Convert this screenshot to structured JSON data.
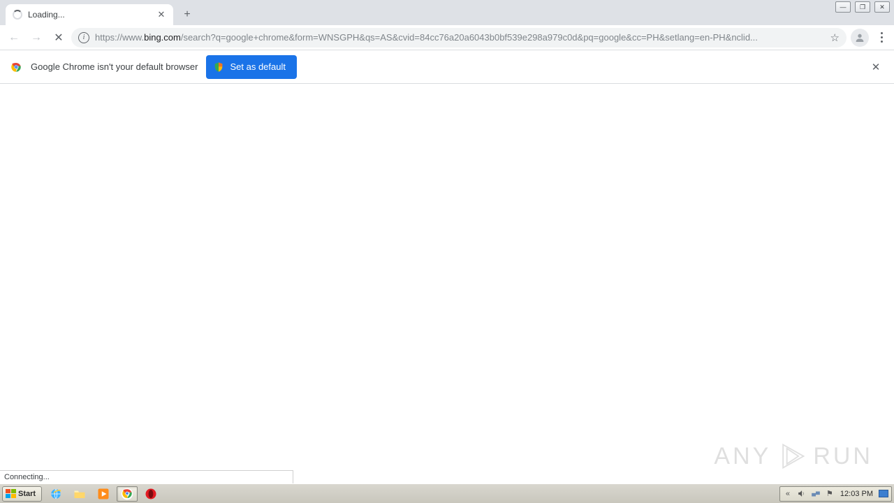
{
  "tab": {
    "title": "Loading..."
  },
  "window_controls": {
    "min": "—",
    "max": "❐",
    "close": "✕"
  },
  "nav": {
    "back": "←",
    "forward": "→",
    "stop": "✕"
  },
  "address": {
    "scheme": "https://",
    "subhost": "www.",
    "host": "bing.com",
    "path": "/search?q=google+chrome&form=WNSGPH&qs=AS&cvid=84cc76a20a6043b0bf539e298a979c0d&pq=google&cc=PH&setlang=en-PH&nclid..."
  },
  "infobar": {
    "message": "Google Chrome isn't your default browser",
    "button": "Set as default"
  },
  "status": "Connecting...",
  "watermark": {
    "left": "ANY",
    "right": "RUN"
  },
  "taskbar": {
    "start": "Start",
    "clock": "12:03 PM"
  },
  "icons": {
    "new_tab": "+",
    "tab_close": "✕",
    "star": "☆",
    "infobar_close": "✕",
    "tray_expand": "«",
    "tray_flag": "⚑"
  }
}
